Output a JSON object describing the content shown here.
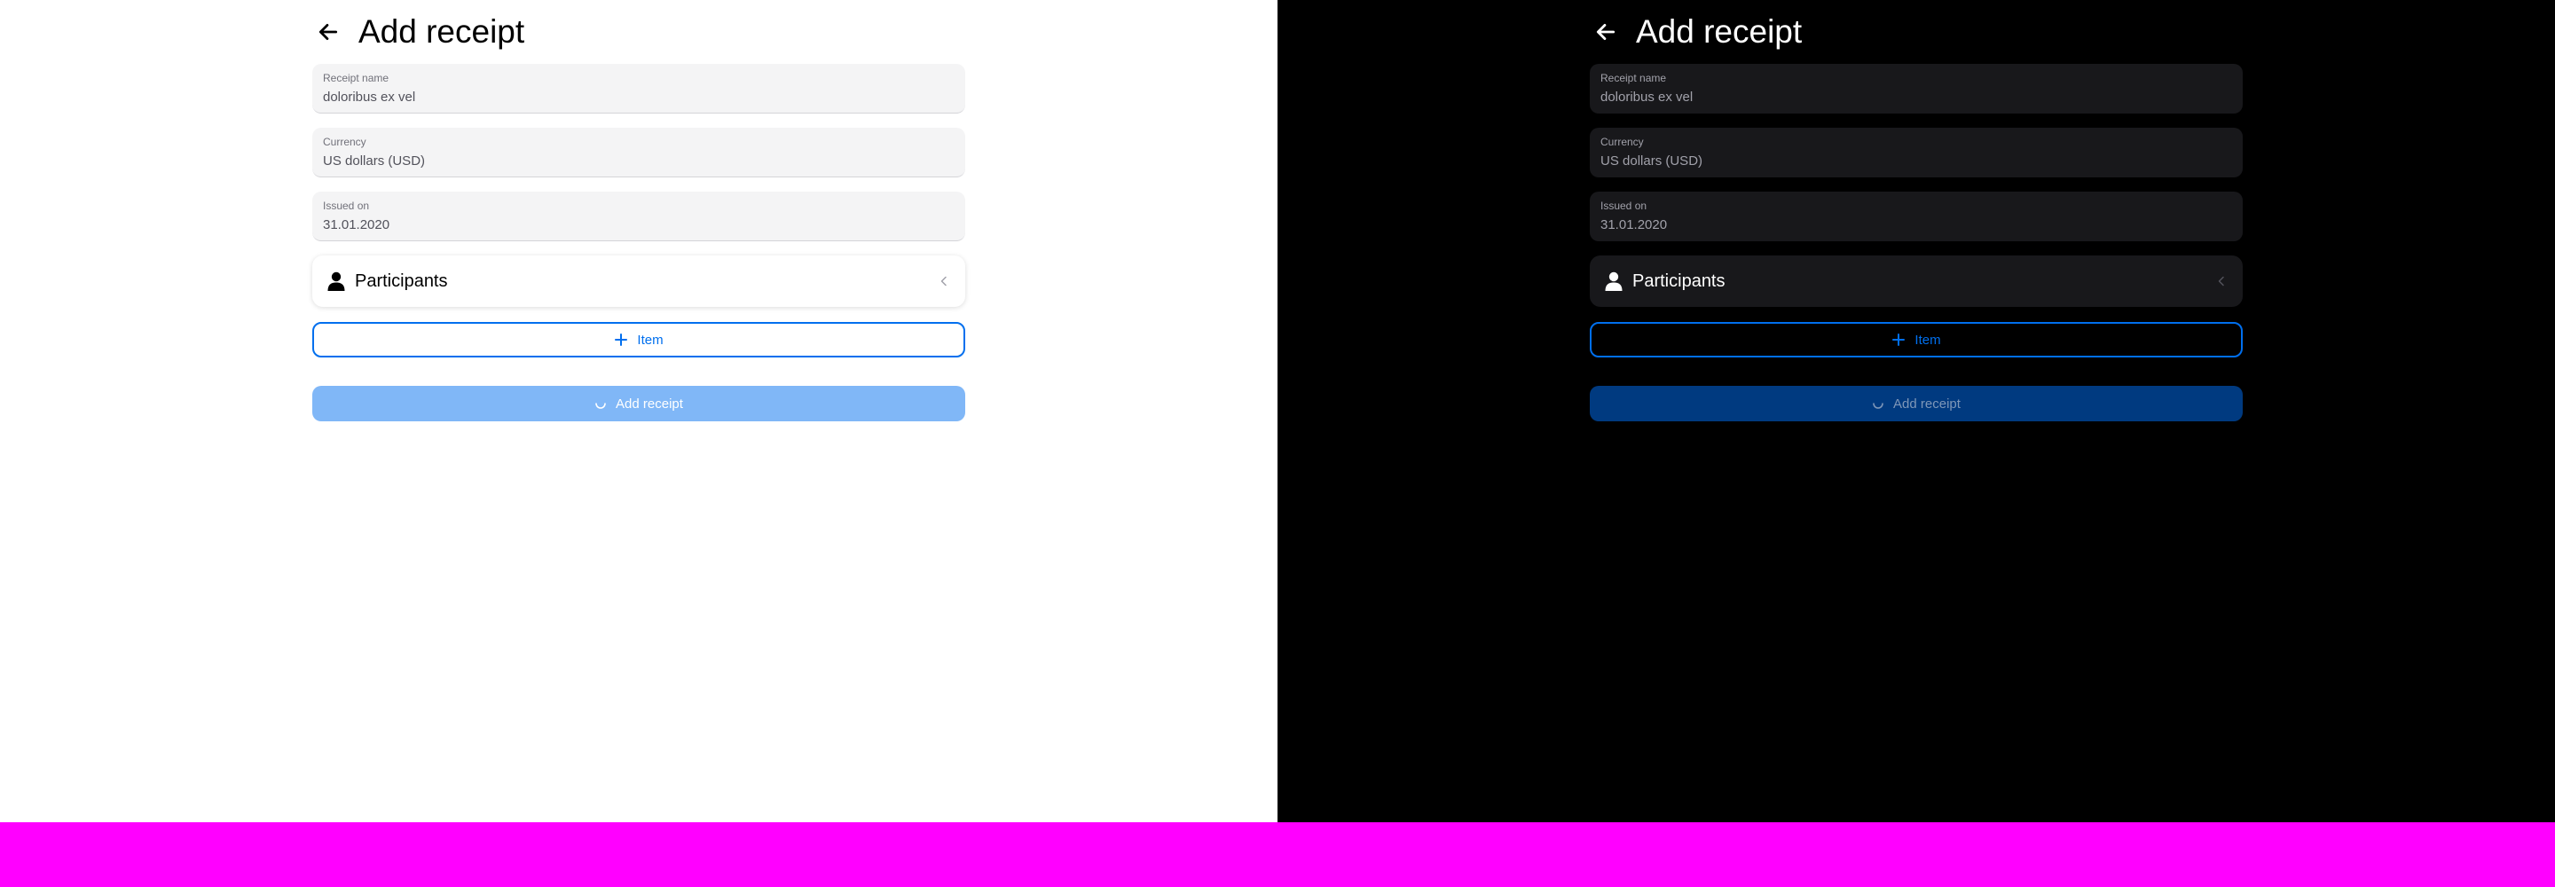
{
  "header": {
    "title": "Add receipt"
  },
  "fields": {
    "receipt_name": {
      "label": "Receipt name",
      "value": "doloribus ex vel"
    },
    "currency": {
      "label": "Currency",
      "value": "US dollars (USD)"
    },
    "issued_on": {
      "label": "Issued on",
      "value": "31.01.2020"
    }
  },
  "participants": {
    "label": "Participants"
  },
  "buttons": {
    "item_label": "Item",
    "submit_label": "Add receipt"
  },
  "colors": {
    "accent": "#006fee",
    "magenta": "#ff00ff"
  }
}
